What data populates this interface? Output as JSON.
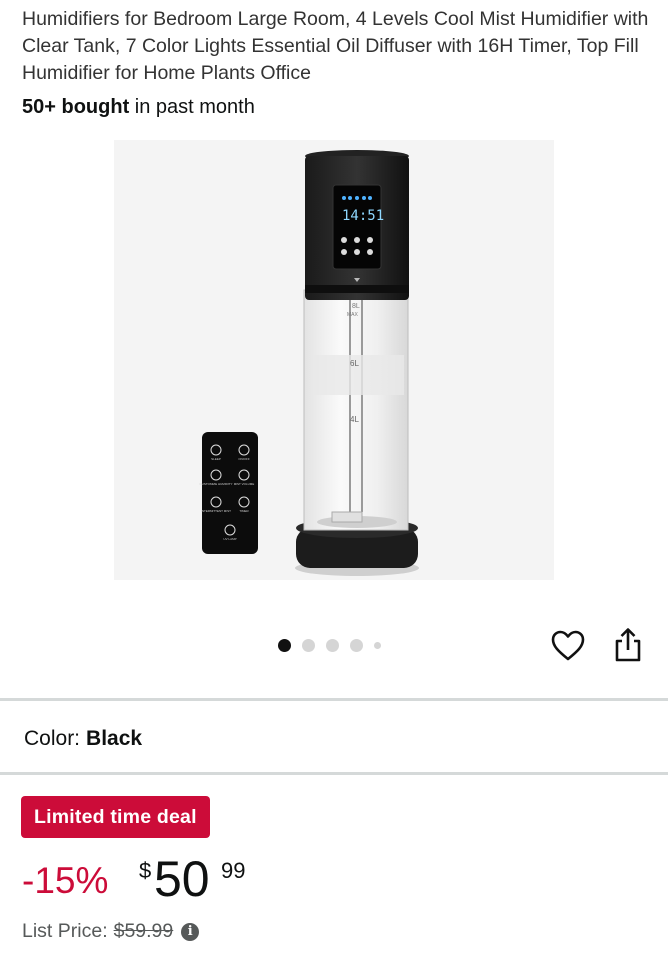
{
  "product": {
    "title": "Humidifiers for Bedroom Large Room, 4 Levels Cool Mist Humidifier with Clear Tank, 7 Color Lights Essential Oil Diffuser with 16H Timer, Top Fill Humidifier for Home Plants Office",
    "bought_count": "50+ bought",
    "bought_suffix": " in past month"
  },
  "image": {
    "display_time": "14:51",
    "tank_marks": [
      "8L",
      "MAX",
      "6L",
      "4L"
    ],
    "remote_buttons": [
      "SLEEP",
      "ON/OFF",
      "CUSTOMIZE HUMIDITY",
      "MIST VOLUME",
      "INTERMITTENT MIST",
      "TIMER",
      "UV LAMP"
    ]
  },
  "carousel": {
    "total": 5,
    "active_index": 0
  },
  "icons": {
    "wishlist": "heart-icon",
    "share": "share-icon",
    "info": "info-icon"
  },
  "color": {
    "label": "Color:",
    "value": "Black"
  },
  "deal": {
    "badge": "Limited time deal",
    "badge_color": "#CC0C39"
  },
  "price": {
    "discount": "-15%",
    "currency": "$",
    "whole": "50",
    "fraction": "99",
    "list_label": "List Price:",
    "list_value": "$59.99",
    "info_glyph": "i"
  }
}
